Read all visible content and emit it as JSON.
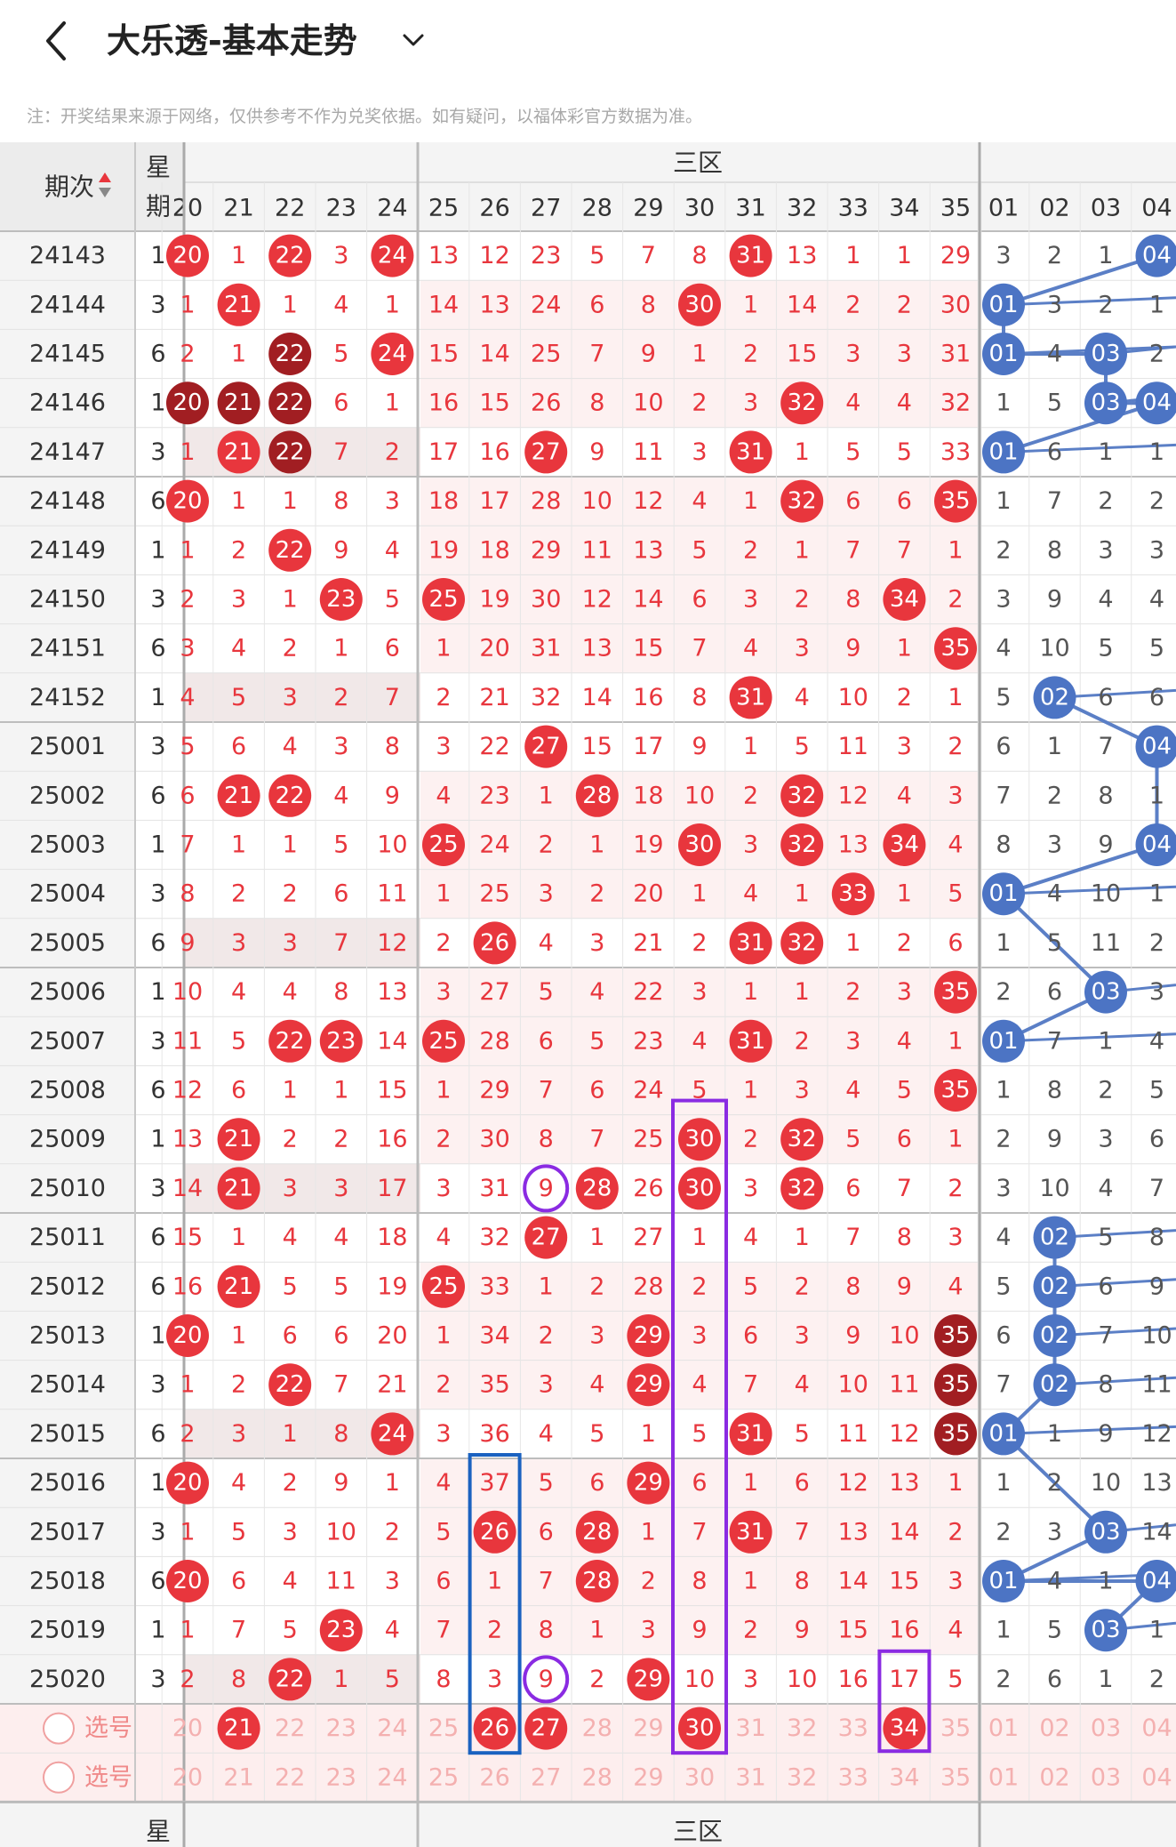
{
  "header": {
    "title": "大乐透-基本走势",
    "note": "注：开奖结果来源于网络，仅供参考不作为兑奖依据。如有疑问，以福体彩官方数据为准。"
  },
  "table": {
    "period_header": "期次",
    "week_header_top": "星",
    "week_header_bottom": "期",
    "zone_label": "三区",
    "front_columns": [
      "20",
      "21",
      "22",
      "23",
      "24",
      "25",
      "26",
      "27",
      "28",
      "29",
      "30",
      "31",
      "32",
      "33",
      "34",
      "35"
    ],
    "back_columns": [
      "01",
      "02",
      "03",
      "04"
    ],
    "rows": [
      {
        "p": "24143",
        "w": "1",
        "f": [
          "20",
          "1",
          "22",
          "3",
          "24",
          "13",
          "12",
          "23",
          "5",
          "7",
          "8",
          "31",
          "13",
          "1",
          "1",
          "29"
        ],
        "b": [
          "3",
          "2",
          "1",
          "04"
        ]
      },
      {
        "p": "24144",
        "w": "3",
        "f": [
          "1",
          "21",
          "1",
          "4",
          "1",
          "14",
          "13",
          "24",
          "6",
          "8",
          "30",
          "1",
          "14",
          "2",
          "2",
          "30"
        ],
        "b": [
          "01",
          "3",
          "2",
          "1"
        ]
      },
      {
        "p": "24145",
        "w": "6",
        "f": [
          "2",
          "1",
          "22",
          "5",
          "24",
          "15",
          "14",
          "25",
          "7",
          "9",
          "1",
          "2",
          "15",
          "3",
          "3",
          "31"
        ],
        "b": [
          "01",
          "4",
          "03",
          "2"
        ]
      },
      {
        "p": "24146",
        "w": "1",
        "f": [
          "20",
          "21",
          "22",
          "6",
          "1",
          "16",
          "15",
          "26",
          "8",
          "10",
          "2",
          "3",
          "32",
          "4",
          "4",
          "32"
        ],
        "b": [
          "1",
          "5",
          "03",
          "04"
        ]
      },
      {
        "p": "24147",
        "w": "3",
        "f": [
          "1",
          "21",
          "22",
          "7",
          "2",
          "17",
          "16",
          "27",
          "9",
          "11",
          "3",
          "31",
          "1",
          "5",
          "5",
          "33"
        ],
        "b": [
          "01",
          "6",
          "1",
          "1"
        ]
      },
      {
        "p": "24148",
        "w": "6",
        "f": [
          "20",
          "1",
          "1",
          "8",
          "3",
          "18",
          "17",
          "28",
          "10",
          "12",
          "4",
          "1",
          "32",
          "6",
          "6",
          "35"
        ],
        "b": [
          "1",
          "7",
          "2",
          "2"
        ]
      },
      {
        "p": "24149",
        "w": "1",
        "f": [
          "1",
          "2",
          "22",
          "9",
          "4",
          "19",
          "18",
          "29",
          "11",
          "13",
          "5",
          "2",
          "1",
          "7",
          "7",
          "1"
        ],
        "b": [
          "2",
          "8",
          "3",
          "3"
        ]
      },
      {
        "p": "24150",
        "w": "3",
        "f": [
          "2",
          "3",
          "1",
          "23",
          "5",
          "25",
          "19",
          "30",
          "12",
          "14",
          "6",
          "3",
          "2",
          "8",
          "34",
          "2"
        ],
        "b": [
          "3",
          "9",
          "4",
          "4"
        ]
      },
      {
        "p": "24151",
        "w": "6",
        "f": [
          "3",
          "4",
          "2",
          "1",
          "6",
          "1",
          "20",
          "31",
          "13",
          "15",
          "7",
          "4",
          "3",
          "9",
          "1",
          "35"
        ],
        "b": [
          "4",
          "10",
          "5",
          "5"
        ]
      },
      {
        "p": "24152",
        "w": "1",
        "f": [
          "4",
          "5",
          "3",
          "2",
          "7",
          "2",
          "21",
          "32",
          "14",
          "16",
          "8",
          "31",
          "4",
          "10",
          "2",
          "1"
        ],
        "b": [
          "5",
          "02",
          "6",
          "6"
        ]
      },
      {
        "p": "25001",
        "w": "3",
        "f": [
          "5",
          "6",
          "4",
          "3",
          "8",
          "3",
          "22",
          "27",
          "15",
          "17",
          "9",
          "1",
          "5",
          "11",
          "3",
          "2"
        ],
        "b": [
          "6",
          "1",
          "7",
          "04"
        ]
      },
      {
        "p": "25002",
        "w": "6",
        "f": [
          "6",
          "21",
          "22",
          "4",
          "9",
          "4",
          "23",
          "1",
          "28",
          "18",
          "10",
          "2",
          "32",
          "12",
          "4",
          "3"
        ],
        "b": [
          "7",
          "2",
          "8",
          "1"
        ]
      },
      {
        "p": "25003",
        "w": "1",
        "f": [
          "7",
          "1",
          "1",
          "5",
          "10",
          "25",
          "24",
          "2",
          "1",
          "19",
          "30",
          "3",
          "32",
          "13",
          "34",
          "4"
        ],
        "b": [
          "8",
          "3",
          "9",
          "04"
        ]
      },
      {
        "p": "25004",
        "w": "3",
        "f": [
          "8",
          "2",
          "2",
          "6",
          "11",
          "1",
          "25",
          "3",
          "2",
          "20",
          "1",
          "4",
          "1",
          "33",
          "1",
          "5"
        ],
        "b": [
          "01",
          "4",
          "10",
          "1"
        ]
      },
      {
        "p": "25005",
        "w": "6",
        "f": [
          "9",
          "3",
          "3",
          "7",
          "12",
          "2",
          "26",
          "4",
          "3",
          "21",
          "2",
          "31",
          "32",
          "1",
          "2",
          "6"
        ],
        "b": [
          "1",
          "5",
          "11",
          "2"
        ]
      },
      {
        "p": "25006",
        "w": "1",
        "f": [
          "10",
          "4",
          "4",
          "8",
          "13",
          "3",
          "27",
          "5",
          "4",
          "22",
          "3",
          "1",
          "1",
          "2",
          "3",
          "35"
        ],
        "b": [
          "2",
          "6",
          "03",
          "3"
        ]
      },
      {
        "p": "25007",
        "w": "3",
        "f": [
          "11",
          "5",
          "22",
          "23",
          "14",
          "25",
          "28",
          "6",
          "5",
          "23",
          "4",
          "31",
          "2",
          "3",
          "4",
          "1"
        ],
        "b": [
          "01",
          "7",
          "1",
          "4"
        ]
      },
      {
        "p": "25008",
        "w": "6",
        "f": [
          "12",
          "6",
          "1",
          "1",
          "15",
          "1",
          "29",
          "7",
          "6",
          "24",
          "5",
          "1",
          "3",
          "4",
          "5",
          "35"
        ],
        "b": [
          "1",
          "8",
          "2",
          "5"
        ]
      },
      {
        "p": "25009",
        "w": "1",
        "f": [
          "13",
          "21",
          "2",
          "2",
          "16",
          "2",
          "30",
          "8",
          "7",
          "25",
          "30",
          "2",
          "32",
          "5",
          "6",
          "1"
        ],
        "b": [
          "2",
          "9",
          "3",
          "6"
        ]
      },
      {
        "p": "25010",
        "w": "3",
        "f": [
          "14",
          "21",
          "3",
          "3",
          "17",
          "3",
          "31",
          "9",
          "28",
          "26",
          "30",
          "3",
          "32",
          "6",
          "7",
          "2"
        ],
        "b": [
          "3",
          "10",
          "4",
          "7"
        ]
      },
      {
        "p": "25011",
        "w": "6",
        "f": [
          "15",
          "1",
          "4",
          "4",
          "18",
          "4",
          "32",
          "27",
          "1",
          "27",
          "1",
          "4",
          "1",
          "7",
          "8",
          "3"
        ],
        "b": [
          "4",
          "02",
          "5",
          "8"
        ]
      },
      {
        "p": "25012",
        "w": "6",
        "f": [
          "16",
          "21",
          "5",
          "5",
          "19",
          "25",
          "33",
          "1",
          "2",
          "28",
          "2",
          "5",
          "2",
          "8",
          "9",
          "4"
        ],
        "b": [
          "5",
          "02",
          "6",
          "9"
        ]
      },
      {
        "p": "25013",
        "w": "1",
        "f": [
          "20",
          "1",
          "6",
          "6",
          "20",
          "1",
          "34",
          "2",
          "3",
          "29",
          "3",
          "6",
          "3",
          "9",
          "10",
          "35"
        ],
        "b": [
          "6",
          "02",
          "7",
          "10"
        ]
      },
      {
        "p": "25014",
        "w": "3",
        "f": [
          "1",
          "2",
          "22",
          "7",
          "21",
          "2",
          "35",
          "3",
          "4",
          "29",
          "4",
          "7",
          "4",
          "10",
          "11",
          "35"
        ],
        "b": [
          "7",
          "02",
          "8",
          "11"
        ]
      },
      {
        "p": "25015",
        "w": "6",
        "f": [
          "2",
          "3",
          "1",
          "8",
          "24",
          "3",
          "36",
          "4",
          "5",
          "1",
          "5",
          "31",
          "5",
          "11",
          "12",
          "35"
        ],
        "b": [
          "01",
          "1",
          "9",
          "12"
        ]
      },
      {
        "p": "25016",
        "w": "1",
        "f": [
          "20",
          "4",
          "2",
          "9",
          "1",
          "4",
          "37",
          "5",
          "6",
          "29",
          "6",
          "1",
          "6",
          "12",
          "13",
          "1"
        ],
        "b": [
          "1",
          "2",
          "10",
          "13"
        ]
      },
      {
        "p": "25017",
        "w": "3",
        "f": [
          "1",
          "5",
          "3",
          "10",
          "2",
          "5",
          "26",
          "6",
          "28",
          "1",
          "7",
          "31",
          "7",
          "13",
          "14",
          "2"
        ],
        "b": [
          "2",
          "3",
          "03",
          "14"
        ]
      },
      {
        "p": "25018",
        "w": "6",
        "f": [
          "20",
          "6",
          "4",
          "11",
          "3",
          "6",
          "1",
          "7",
          "28",
          "2",
          "8",
          "1",
          "8",
          "14",
          "15",
          "3"
        ],
        "b": [
          "01",
          "4",
          "1",
          "04"
        ]
      },
      {
        "p": "25019",
        "w": "1",
        "f": [
          "1",
          "7",
          "5",
          "23",
          "4",
          "7",
          "2",
          "8",
          "1",
          "3",
          "9",
          "2",
          "9",
          "15",
          "16",
          "4"
        ],
        "b": [
          "1",
          "5",
          "03",
          "1"
        ]
      },
      {
        "p": "25020",
        "w": "3",
        "f": [
          "2",
          "8",
          "22",
          "1",
          "5",
          "8",
          "3",
          "9",
          "2",
          "29",
          "10",
          "3",
          "10",
          "16",
          "17",
          "5"
        ],
        "b": [
          "2",
          "6",
          "1",
          "2"
        ]
      }
    ],
    "select_rows": [
      {
        "label": "选号",
        "f": [
          "20",
          "21",
          "22",
          "23",
          "24",
          "25",
          "26",
          "27",
          "28",
          "29",
          "30",
          "31",
          "32",
          "33",
          "34",
          "35"
        ],
        "b": [
          "01",
          "02",
          "03",
          "04"
        ]
      },
      {
        "label": "选号",
        "f": [
          "20",
          "21",
          "22",
          "23",
          "24",
          "25",
          "26",
          "27",
          "28",
          "29",
          "30",
          "31",
          "32",
          "33",
          "34",
          "35"
        ],
        "b": [
          "01",
          "02",
          "03",
          "04"
        ]
      }
    ],
    "selected_front": [
      "21",
      "26",
      "27",
      "30",
      "34"
    ],
    "dark_balls": [
      [
        "24146",
        "20"
      ],
      [
        "24146",
        "21"
      ],
      [
        "24146",
        "22"
      ],
      [
        "24145",
        "22"
      ],
      [
        "24147",
        "22"
      ],
      [
        "25013",
        "35"
      ],
      [
        "25014",
        "35"
      ],
      [
        "25015",
        "35"
      ]
    ],
    "circled": [
      [
        "25010",
        "27"
      ],
      [
        "25020",
        "27"
      ]
    ]
  },
  "colors": {
    "red_ball": "#e8363d",
    "dark_ball": "#a11e22",
    "blue_ball": "#4c74c4",
    "blue_line": "#5b7fc6",
    "grid_line": "#c8c8c8",
    "purple_mark": "#8a2be2",
    "blue_mark": "#1b62c0"
  }
}
